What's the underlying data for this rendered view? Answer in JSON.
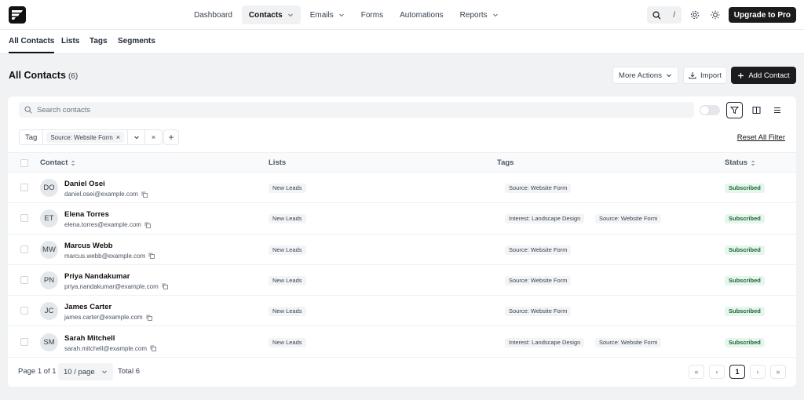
{
  "nav": {
    "items": [
      {
        "label": "Dashboard",
        "dropdown": false,
        "active": false
      },
      {
        "label": "Contacts",
        "dropdown": true,
        "active": true
      },
      {
        "label": "Emails",
        "dropdown": true,
        "active": false
      },
      {
        "label": "Forms",
        "dropdown": false,
        "active": false
      },
      {
        "label": "Automations",
        "dropdown": false,
        "active": false
      },
      {
        "label": "Reports",
        "dropdown": true,
        "active": false
      }
    ],
    "search_shortcut": "/",
    "upgrade_label": "Upgrade to Pro"
  },
  "subnav": {
    "tabs": [
      {
        "label": "All Contacts",
        "active": true
      },
      {
        "label": "Lists",
        "active": false
      },
      {
        "label": "Tags",
        "active": false
      },
      {
        "label": "Segments",
        "active": false
      }
    ]
  },
  "header": {
    "title": "All Contacts",
    "count": "(6)",
    "more_actions_label": "More Actions",
    "import_label": "Import",
    "add_contact_label": "Add Contact"
  },
  "search": {
    "placeholder": "Search contacts"
  },
  "filter": {
    "field": "Tag",
    "chip": "Source: Website Form",
    "reset_label": "Reset All Filter"
  },
  "table": {
    "columns": [
      "Contact",
      "Lists",
      "Tags",
      "Status"
    ],
    "rows": [
      {
        "initials": "DO",
        "name": "Daniel Osei",
        "email": "daniel.osei@example.com",
        "list": "New Leads",
        "tags": [
          "Source: Website Form"
        ],
        "status": "Subscribed"
      },
      {
        "initials": "ET",
        "name": "Elena Torres",
        "email": "elena.torres@example.com",
        "list": "New Leads",
        "tags": [
          "Interest: Landscape Design",
          "Source: Website Form"
        ],
        "status": "Subscribed"
      },
      {
        "initials": "MW",
        "name": "Marcus Webb",
        "email": "marcus.webb@example.com",
        "list": "New Leads",
        "tags": [
          "Source: Website Form"
        ],
        "status": "Subscribed"
      },
      {
        "initials": "PN",
        "name": "Priya Nandakumar",
        "email": "priya.nandakumar@example.com",
        "list": "New Leads",
        "tags": [
          "Source: Website Form"
        ],
        "status": "Subscribed"
      },
      {
        "initials": "JC",
        "name": "James Carter",
        "email": "james.carter@example.com",
        "list": "New Leads",
        "tags": [
          "Source: Website Form"
        ],
        "status": "Subscribed"
      },
      {
        "initials": "SM",
        "name": "Sarah Mitchell",
        "email": "sarah.mitchell@example.com",
        "list": "New Leads",
        "tags": [
          "Interest: Landscape Design",
          "Source: Website Form"
        ],
        "status": "Subscribed"
      }
    ]
  },
  "footer": {
    "page_info": "Page 1 of 1",
    "per_page": "10 / page",
    "total": "Total 6",
    "current_page": "1"
  },
  "colors": {
    "accent": "#1c1c1f",
    "status_bg": "#e7f6ec",
    "status_text": "#166534"
  },
  "icons": [
    "logo-icon",
    "search-icon",
    "settings-icon",
    "sun-icon",
    "chevron-down-icon",
    "download-icon",
    "plus-icon",
    "filter-icon",
    "columns-icon",
    "menu-icon",
    "copy-icon",
    "sort-icon",
    "close-icon"
  ]
}
